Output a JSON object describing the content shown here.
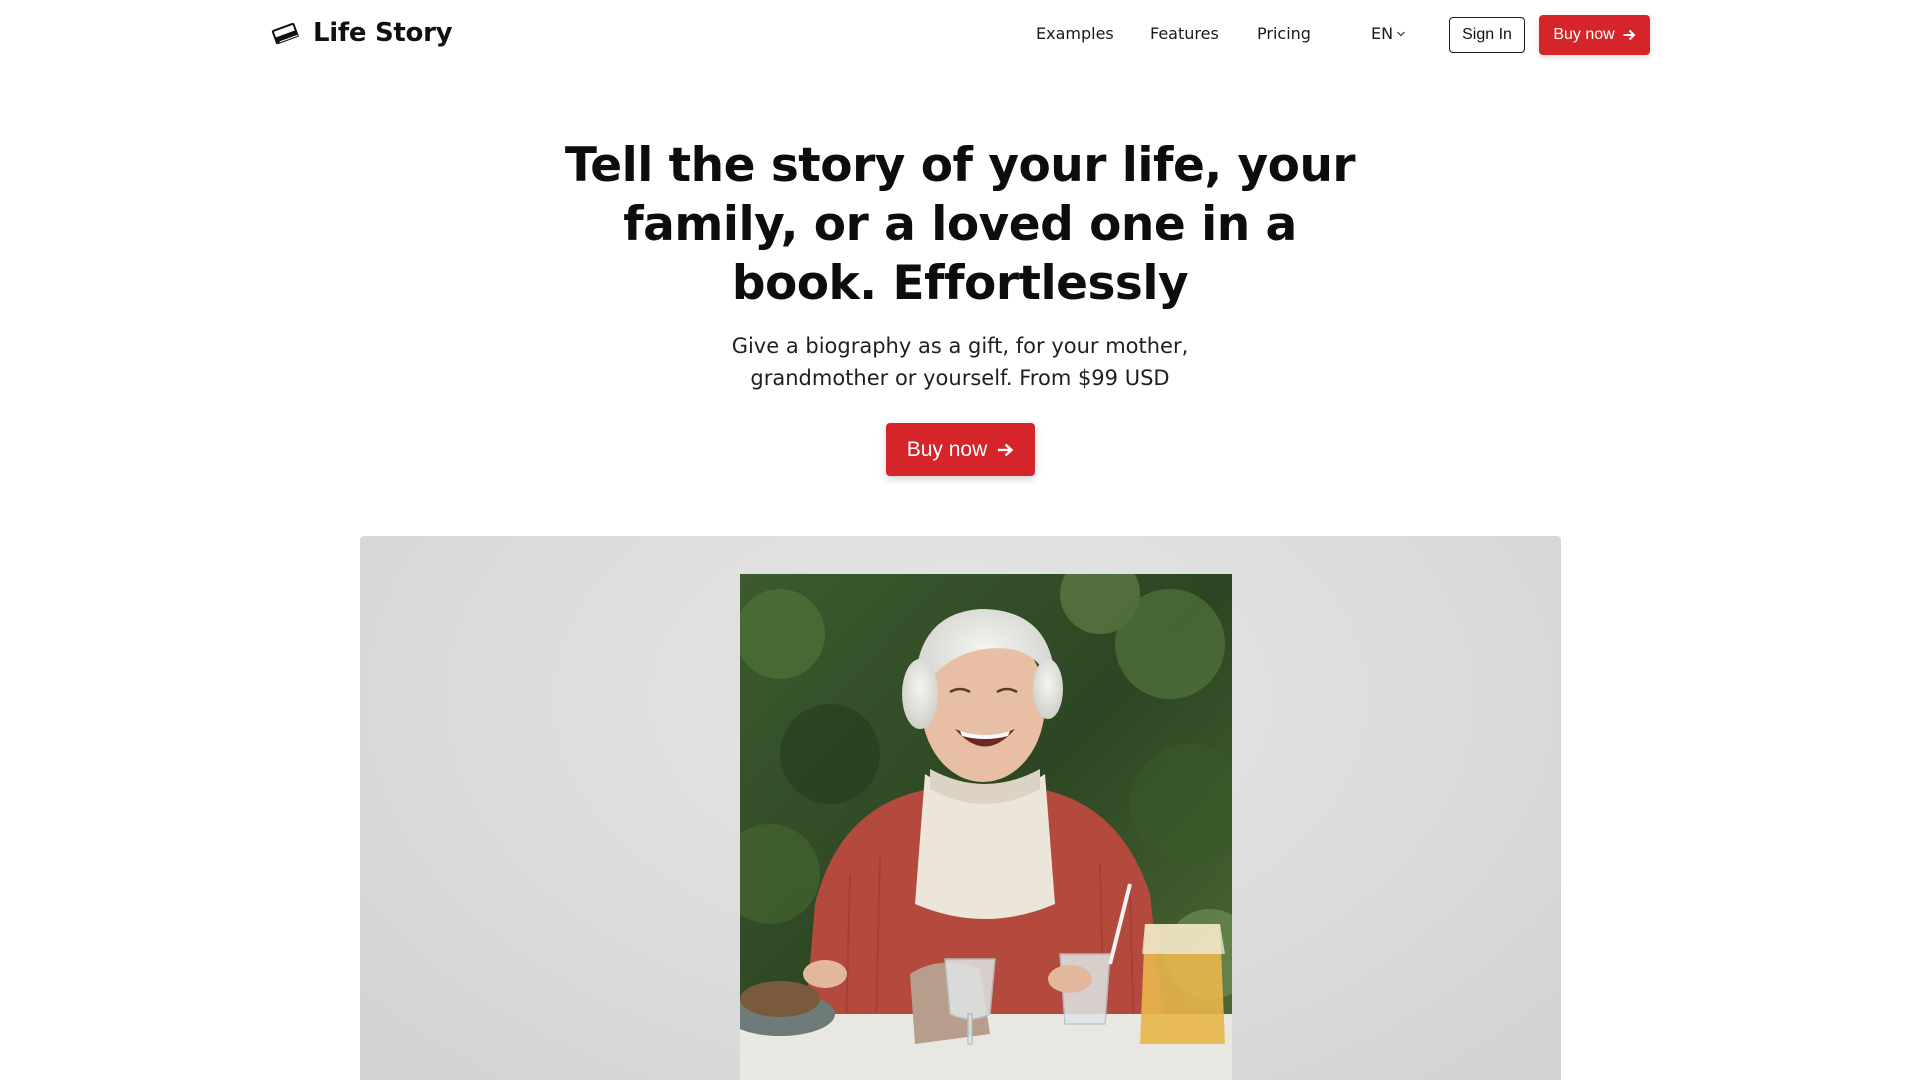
{
  "header": {
    "logo_text": "Life Story",
    "logo_icon": "book-icon",
    "nav": [
      {
        "label": "Examples"
      },
      {
        "label": "Features"
      },
      {
        "label": "Pricing"
      }
    ],
    "language": "EN",
    "sign_in_label": "Sign In",
    "buy_label": "Buy now"
  },
  "hero": {
    "title": "Tell the story of your life, your family, or a loved one in a book. Effortlessly",
    "subtitle": "Give a biography as a gift, for your mother, grandmother or yourself. From $99 USD",
    "cta_label": "Buy now"
  },
  "colors": {
    "accent": "#d6242b",
    "showcase_bg": "#dcdcdc"
  }
}
